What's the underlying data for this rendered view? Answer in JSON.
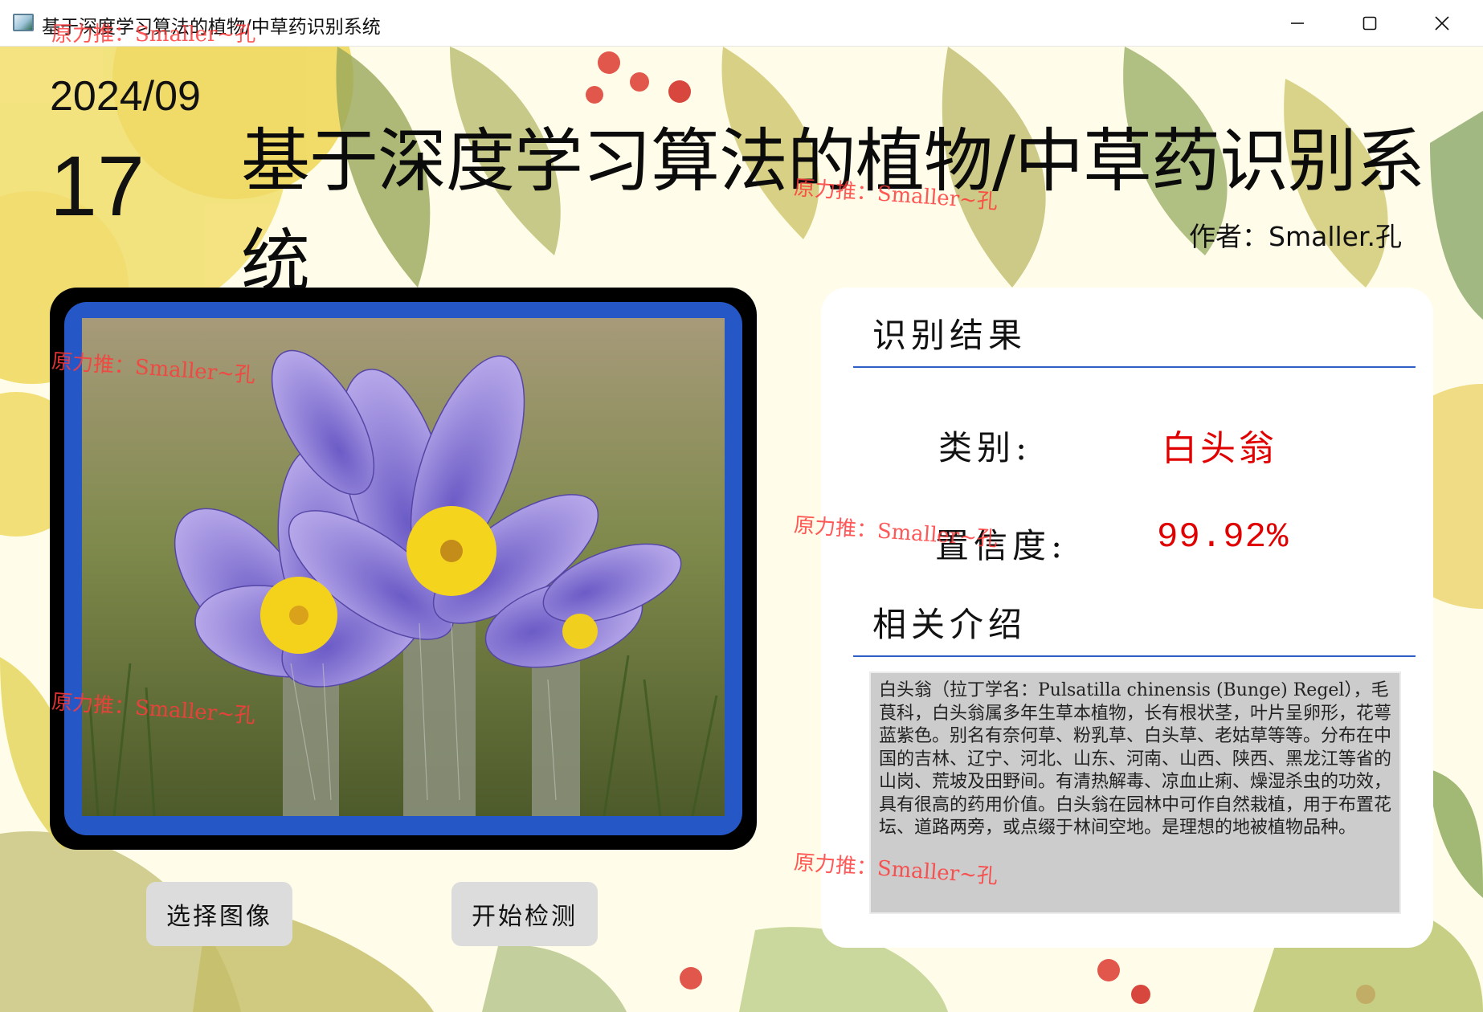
{
  "window": {
    "title": "基于深度学习算法的植物/中草药识别系统",
    "controls": {
      "minimize": "minimize-icon",
      "maximize": "maximize-icon",
      "close": "close-icon"
    }
  },
  "header": {
    "date_year_month": "2024/09",
    "date_day": "17",
    "title": "基于深度学习算法的植物/中草药识别系统",
    "author": "作者：Smaller.孔"
  },
  "watermark": "原力推：Smaller~孔",
  "buttons": {
    "select_image": "选择图像",
    "start_detect": "开始检测"
  },
  "results": {
    "section_result": "识别结果",
    "category_label": "类别:",
    "category_value": "白头翁",
    "confidence_label": "置信度:",
    "confidence_value": "99.92%",
    "section_intro": "相关介绍",
    "intro_text": "白头翁（拉丁学名：Pulsatilla chinensis (Bunge) Regel），毛茛科，白头翁属多年生草本植物，长有根状茎，叶片呈卵形，花萼蓝紫色。别名有奈何草、粉乳草、白头草、老姑草等等。分布在中国的吉林、辽宁、河北、山东、河南、山西、陕西、黑龙江等省的山岗、荒坡及田野间。有清热解毒、凉血止痢、燥湿杀虫的功效，具有很高的药用价值。白头翁在园林中可作自然栽植，用于布置花坛、道路两旁，或点缀于林间空地。是理想的地被植物品种。"
  },
  "colors": {
    "accent_blue": "#2657c6",
    "value_red": "#e00000",
    "panel_bg": "#ffffff",
    "page_bg": "#fffde9"
  }
}
